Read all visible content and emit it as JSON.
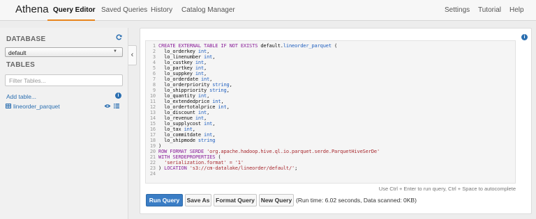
{
  "app": {
    "brand": "Athena"
  },
  "nav": {
    "left_items": [
      "Query Editor",
      "Saved Queries",
      "History",
      "Catalog Manager"
    ],
    "right_items": [
      "Settings",
      "Tutorial",
      "Help"
    ],
    "active": "Query Editor",
    "accent_color": "#e8851d"
  },
  "sidebar": {
    "database_heading": "DATABASE",
    "database_value": "default",
    "tables_heading": "TABLES",
    "filter_placeholder": "Filter Tables...",
    "add_table_label": "Add table...",
    "tables": [
      "lineorder_parquet"
    ],
    "icons": [
      "refresh-icon",
      "info-icon",
      "table-icon",
      "eye-icon",
      "list-icon"
    ]
  },
  "editor": {
    "lines": [
      [
        [
          "kw",
          "CREATE EXTERNAL TABLE IF NOT EXISTS "
        ],
        [
          "plain",
          "default."
        ],
        [
          "type",
          "lineorder_parquet"
        ],
        [
          "plain",
          " ("
        ]
      ],
      [
        [
          "plain",
          "  lo_orderkey "
        ],
        [
          "type",
          "int"
        ],
        [
          "plain",
          ","
        ]
      ],
      [
        [
          "plain",
          "  lo_linenumber "
        ],
        [
          "type",
          "int"
        ],
        [
          "plain",
          ","
        ]
      ],
      [
        [
          "plain",
          "  lo_custkey "
        ],
        [
          "type",
          "int"
        ],
        [
          "plain",
          ","
        ]
      ],
      [
        [
          "plain",
          "  lo_partkey "
        ],
        [
          "type",
          "int"
        ],
        [
          "plain",
          ","
        ]
      ],
      [
        [
          "plain",
          "  lo_suppkey "
        ],
        [
          "type",
          "int"
        ],
        [
          "plain",
          ","
        ]
      ],
      [
        [
          "plain",
          "  lo_orderdate "
        ],
        [
          "type",
          "int"
        ],
        [
          "plain",
          ","
        ]
      ],
      [
        [
          "plain",
          "  lo_orderpriority "
        ],
        [
          "type",
          "string"
        ],
        [
          "plain",
          ","
        ]
      ],
      [
        [
          "plain",
          "  lo_shippriority "
        ],
        [
          "type",
          "string"
        ],
        [
          "plain",
          ","
        ]
      ],
      [
        [
          "plain",
          "  lo_quantity "
        ],
        [
          "type",
          "int"
        ],
        [
          "plain",
          ","
        ]
      ],
      [
        [
          "plain",
          "  lo_extendedprice "
        ],
        [
          "type",
          "int"
        ],
        [
          "plain",
          ","
        ]
      ],
      [
        [
          "plain",
          "  lo_ordertotalprice "
        ],
        [
          "type",
          "int"
        ],
        [
          "plain",
          ","
        ]
      ],
      [
        [
          "plain",
          "  lo_discount "
        ],
        [
          "type",
          "int"
        ],
        [
          "plain",
          ","
        ]
      ],
      [
        [
          "plain",
          "  lo_revenue "
        ],
        [
          "type",
          "int"
        ],
        [
          "plain",
          ","
        ]
      ],
      [
        [
          "plain",
          "  lo_supplycost "
        ],
        [
          "type",
          "int"
        ],
        [
          "plain",
          ","
        ]
      ],
      [
        [
          "plain",
          "  lo_tax "
        ],
        [
          "type",
          "int"
        ],
        [
          "plain",
          ","
        ]
      ],
      [
        [
          "plain",
          "  lo_commitdate "
        ],
        [
          "type",
          "int"
        ],
        [
          "plain",
          ","
        ]
      ],
      [
        [
          "plain",
          "  lo_shipmode "
        ],
        [
          "type",
          "string"
        ]
      ],
      [
        [
          "plain",
          ")"
        ]
      ],
      [
        [
          "kw",
          "ROW FORMAT SERDE "
        ],
        [
          "str",
          "'org.apache.hadoop.hive.ql.io.parquet.serde.ParquetHiveSerDe'"
        ]
      ],
      [
        [
          "kw",
          "WITH SERDEPROPERTIES"
        ],
        [
          "plain",
          " ("
        ]
      ],
      [
        [
          "str",
          "  'serialization.format' = '1'"
        ]
      ],
      [
        [
          "plain",
          ") "
        ],
        [
          "kw",
          "LOCATION "
        ],
        [
          "str",
          "'s3://cm-datalake/lineorder/default/'"
        ],
        [
          "plain",
          ";"
        ]
      ],
      []
    ],
    "hint": "Use Ctrl + Enter to run query, Ctrl + Space to autocomplete"
  },
  "actions": {
    "run_label": "Run Query",
    "save_label": "Save As",
    "format_label": "Format Query",
    "new_label": "New Query",
    "status": "(Run time: 6.02 seconds, Data scanned: 0KB)"
  }
}
